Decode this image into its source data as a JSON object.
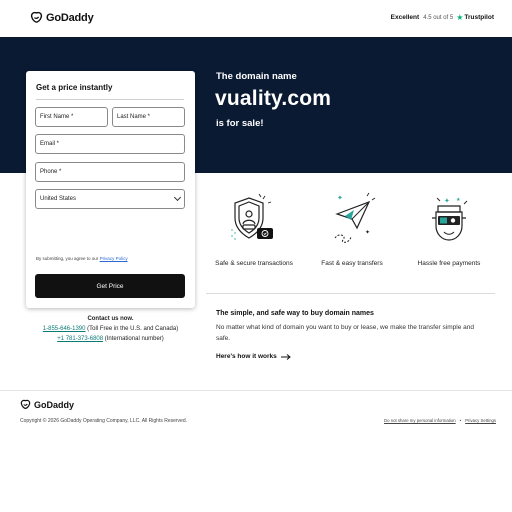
{
  "header": {
    "brand": "GoDaddy",
    "trust_label": "Excellent",
    "trust_rating": "4.5 out of 5",
    "trust_brand": "Trustpilot"
  },
  "hero": {
    "eyebrow": "The domain name",
    "domain": "vuality.com",
    "tagline": "is for sale!"
  },
  "form": {
    "title": "Get a price instantly",
    "first_name": "First Name *",
    "last_name": "Last Name *",
    "email": "Email *",
    "phone": "Phone *",
    "country": "United States",
    "agree_prefix": "By submitting, you agree to our",
    "privacy_link": "Privacy Policy",
    "submit": "Get Price"
  },
  "contact": {
    "heading": "Contact us now.",
    "phone1": "1-855-646-1390",
    "phone1_note": "(Toll Free in the U.S. and Canada)",
    "phone2": "+1 781-373-6808",
    "phone2_note": "(International number)"
  },
  "features": [
    {
      "icon": "shield-lock-icon",
      "label": "Safe & secure transactions"
    },
    {
      "icon": "paper-plane-icon",
      "label": "Fast & easy transfers"
    },
    {
      "icon": "money-face-icon",
      "label": "Hassle free payments"
    }
  ],
  "info": {
    "heading": "The simple, and safe way to buy domain names",
    "body": "No matter what kind of domain you want to buy or lease, we make the transfer simple and safe.",
    "link": "Here's how it works"
  },
  "footer": {
    "brand": "GoDaddy",
    "copyright": "Copyright © 2026 GoDaddy Operating Company, LLC. All Rights Reserved.",
    "do_not_share": "Do not share my personal information",
    "privacy_settings": "Privacy Settings"
  },
  "colors": {
    "hero_bg": "#0a1a33",
    "accent_teal": "#0b7a75",
    "trustpilot_green": "#00b67a"
  }
}
